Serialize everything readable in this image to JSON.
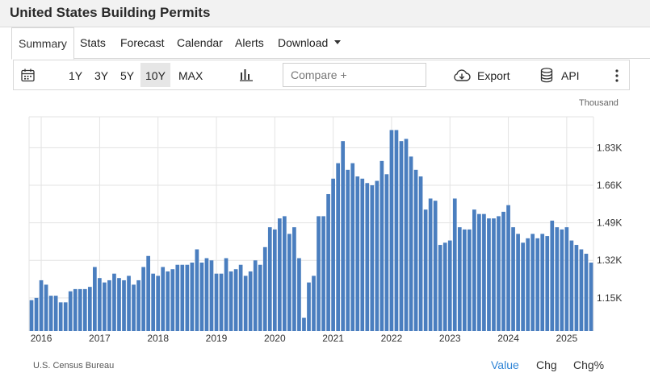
{
  "page": {
    "title": "United States Building Permits"
  },
  "tabs": [
    {
      "label": "Summary",
      "active": true
    },
    {
      "label": "Stats"
    },
    {
      "label": "Forecast"
    },
    {
      "label": "Calendar"
    },
    {
      "label": "Alerts"
    },
    {
      "label": "Download",
      "dropdown": true
    }
  ],
  "toolbar": {
    "calendar_icon": "calendar-icon",
    "ranges": [
      "1Y",
      "3Y",
      "5Y",
      "10Y",
      "MAX"
    ],
    "active_range": "10Y",
    "chart_type_icon": "bar-chart-icon",
    "compare_placeholder": "Compare +",
    "export_label": "Export",
    "export_icon": "cloud-download-icon",
    "api_label": "API",
    "api_icon": "database-icon",
    "more_icon": "more-vertical-icon"
  },
  "chart_data": {
    "type": "bar",
    "unit_label": "Thousand",
    "color": "#4a7ebf",
    "grid": true,
    "y_axis_side": "right",
    "ylim": [
      1.0,
      1.97
    ],
    "yticks": [
      "1.15K",
      "1.32K",
      "1.49K",
      "1.66K",
      "1.83K"
    ],
    "ytick_values": [
      1.15,
      1.32,
      1.49,
      1.66,
      1.83
    ],
    "xticks": [
      "2016",
      "2017",
      "2018",
      "2019",
      "2020",
      "2021",
      "2022",
      "2023",
      "2024",
      "2025"
    ],
    "start": "2015-11",
    "values": [
      1.14,
      1.15,
      1.23,
      1.21,
      1.16,
      1.16,
      1.13,
      1.13,
      1.18,
      1.19,
      1.19,
      1.19,
      1.2,
      1.29,
      1.24,
      1.22,
      1.23,
      1.26,
      1.24,
      1.23,
      1.25,
      1.21,
      1.23,
      1.29,
      1.34,
      1.26,
      1.25,
      1.29,
      1.27,
      1.28,
      1.3,
      1.3,
      1.3,
      1.31,
      1.37,
      1.31,
      1.33,
      1.32,
      1.26,
      1.26,
      1.33,
      1.27,
      1.28,
      1.3,
      1.25,
      1.27,
      1.32,
      1.3,
      1.38,
      1.47,
      1.46,
      1.51,
      1.52,
      1.44,
      1.47,
      1.33,
      1.06,
      1.22,
      1.25,
      1.52,
      1.52,
      1.62,
      1.69,
      1.76,
      1.86,
      1.73,
      1.76,
      1.7,
      1.69,
      1.67,
      1.66,
      1.68,
      1.77,
      1.71,
      1.91,
      1.91,
      1.86,
      1.87,
      1.79,
      1.73,
      1.7,
      1.55,
      1.6,
      1.59,
      1.39,
      1.4,
      1.41,
      1.6,
      1.47,
      1.46,
      1.46,
      1.55,
      1.53,
      1.53,
      1.51,
      1.51,
      1.52,
      1.54,
      1.57,
      1.47,
      1.44,
      1.4,
      1.42,
      1.44,
      1.42,
      1.44,
      1.43,
      1.5,
      1.47,
      1.46,
      1.47,
      1.41,
      1.39,
      1.37,
      1.35,
      1.31
    ]
  },
  "footer": {
    "source": "U.S. Census Bureau",
    "views": [
      "Value",
      "Chg",
      "Chg%"
    ],
    "active_view": "Value"
  }
}
